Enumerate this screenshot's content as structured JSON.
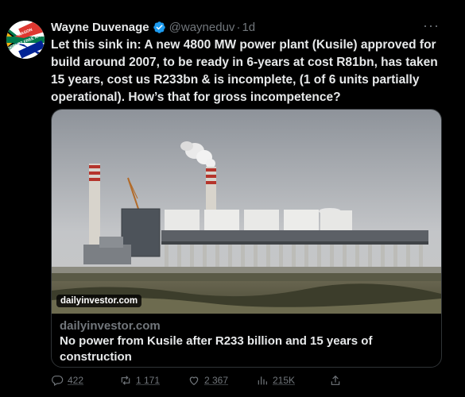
{
  "tweet": {
    "author": {
      "display_name": "Wayne Duvenage",
      "handle": "@wayneduv",
      "separator": "·",
      "time": "1d",
      "avatar_label": "CORRUPT FREE NATION",
      "avatar_label_top": "WAGON"
    },
    "more_label": "···",
    "text": "Let this sink in: A new 4800 MW power plant (Kusile) approved for build around 2007, to be ready in 6-years at cost R81bn, has taken 15 years, cost us R233bn & is incomplete, (1 of 6 units partially operational). How’s that for gross incompetence?",
    "card": {
      "image_badge": "dailyinvestor.com",
      "domain": "dailyinvestor.com",
      "title": "No power from Kusile after R233 billion and 15 years of construction"
    },
    "actions": {
      "replies": "422",
      "retweets": "1 171",
      "likes": "2 367",
      "views": "215K"
    }
  },
  "icons": {
    "verified": "verified-badge-icon",
    "reply": "reply-icon",
    "retweet": "retweet-icon",
    "like": "heart-icon",
    "views": "bar-chart-icon",
    "share": "share-icon"
  },
  "colors": {
    "background": "#000000",
    "text": "#e7e9ea",
    "muted": "#71767b",
    "verified": "#1d9bf0"
  }
}
